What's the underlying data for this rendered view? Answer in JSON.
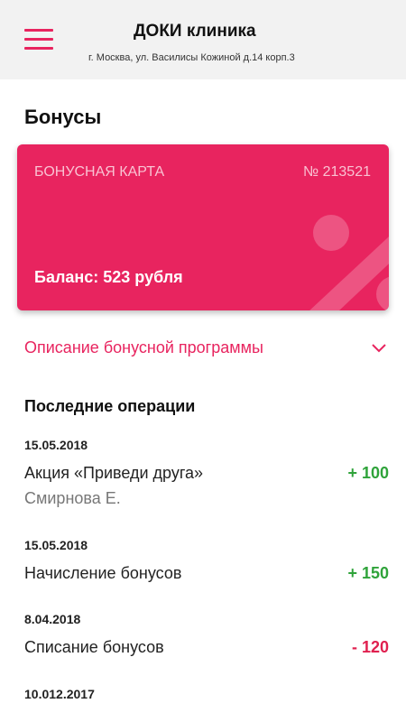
{
  "header": {
    "clinic_name": "ДОКИ клиника",
    "address": "г. Москва, ул. Василисы Кожиной д.14 корп.3",
    "menu_icon": "hamburger-menu-icon"
  },
  "page": {
    "title": "Бонусы"
  },
  "card": {
    "label": "БОНУСНАЯ КАРТА",
    "number": "№ 213521",
    "balance": "Баланс: 523 рубля",
    "color": "#e8245f",
    "decor_icon": "percent-icon"
  },
  "program": {
    "link_label": "Описание бонусной программы",
    "chevron_icon": "chevron-down-icon"
  },
  "operations": {
    "title": "Последние операции",
    "items": [
      {
        "date": "15.05.2018",
        "title": "Акция «Приведи друга»",
        "subtitle": "Смирнова Е.",
        "amount": "+ 100"
      },
      {
        "date": "15.05.2018",
        "title": "Начисление бонусов",
        "amount": "+ 150"
      },
      {
        "date": "8.04.2018",
        "title": "Списание бонусов",
        "amount": "- 120"
      },
      {
        "date": "10.012.2017"
      }
    ]
  },
  "colors": {
    "accent": "#e8245f",
    "positive": "#2fa33a",
    "negative": "#e0204f"
  }
}
